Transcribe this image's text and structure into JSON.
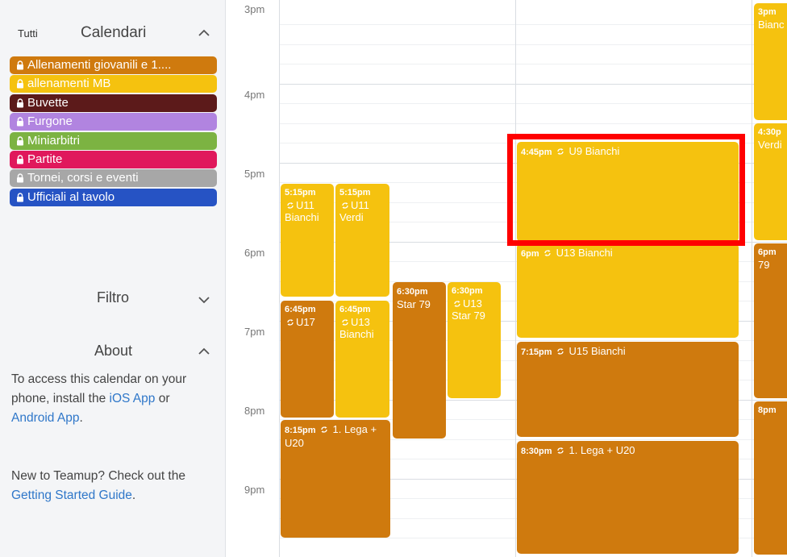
{
  "sidebar": {
    "calendars_header": {
      "all_label": "Tutti",
      "title": "Calendari"
    },
    "calendars": [
      {
        "label": "Allenamenti giovanili e 1....",
        "color": "#cf7a0e"
      },
      {
        "label": "allenamenti MB",
        "color": "#f5c20f"
      },
      {
        "label": "Buvette",
        "color": "#5c1a1a"
      },
      {
        "label": "Furgone",
        "color": "#b184e0"
      },
      {
        "label": "Miniarbitri",
        "color": "#7cb342"
      },
      {
        "label": "Partite",
        "color": "#e0185c"
      },
      {
        "label": "Tornei, corsi e eventi",
        "color": "#a7a7a7"
      },
      {
        "label": "Ufficiali al tavolo",
        "color": "#2653c4"
      }
    ],
    "filter": {
      "title": "Filtro"
    },
    "about": {
      "title": "About",
      "p1_before": "To access this calendar on your phone, install the ",
      "ios_link": "iOS App",
      "p1_or": " or ",
      "android_link": "Android App",
      "p1_end": ".",
      "p2_before": "New to Teamup? Check out the ",
      "guide_link": "Getting Started Guide",
      "p2_end": "."
    }
  },
  "hours": [
    "3pm",
    "4pm",
    "5pm",
    "6pm",
    "7pm",
    "8pm",
    "9pm"
  ],
  "events": {
    "e1": {
      "time": "5:15pm",
      "title": "U11 Bianchi"
    },
    "e2": {
      "time": "5:15pm",
      "title": "U11 Verdi"
    },
    "e3": {
      "time": "6:45pm",
      "title": "U17"
    },
    "e4": {
      "time": "6:45pm",
      "title": "U13 Bianchi"
    },
    "e5": {
      "time": "8:15pm",
      "title": "1. Lega + U20"
    },
    "e6": {
      "time": "6:30pm",
      "title": "Star 79"
    },
    "e7": {
      "time": "6:30pm",
      "title": "U13 Star 79"
    },
    "e8": {
      "time": "4:45pm",
      "title": "U9 Bianchi"
    },
    "e9": {
      "time": "6pm",
      "title": "U13 Bianchi"
    },
    "e10": {
      "time": "7:15pm",
      "title": "U15 Bianchi"
    },
    "e11": {
      "time": "8:30pm",
      "title": "1. Lega + U20"
    },
    "e12": {
      "time": "3pm",
      "title": "Bianc"
    },
    "e13": {
      "time": "4:30p",
      "title": "Verdi"
    },
    "e14": {
      "time": "6pm",
      "title": "79"
    },
    "e15": {
      "time": "8pm",
      "title": ""
    }
  },
  "colors": {
    "highlight": "#ff0000",
    "link": "#2f77c9"
  }
}
